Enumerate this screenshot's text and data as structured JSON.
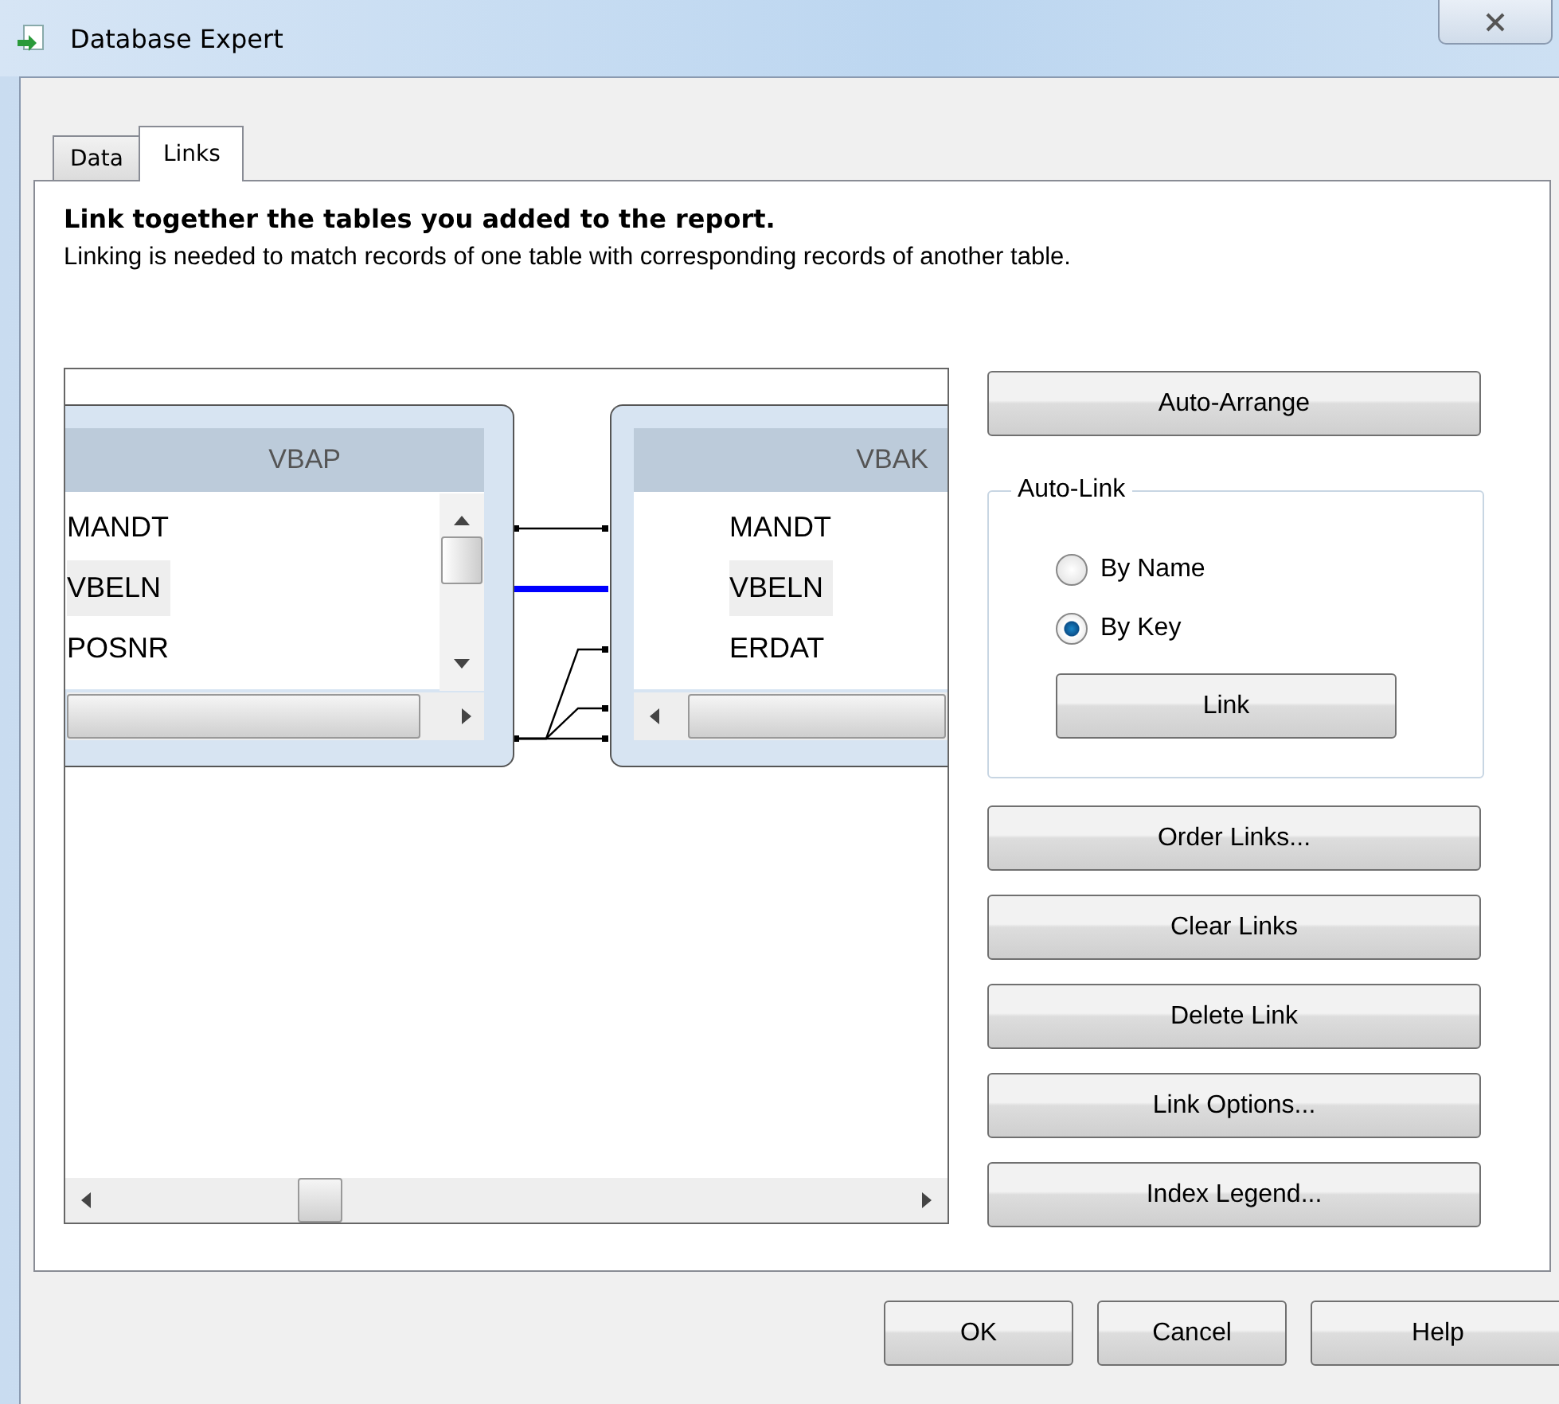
{
  "window": {
    "title": "Database Expert"
  },
  "tabs": [
    {
      "label": "Data",
      "selected": false
    },
    {
      "label": "Links",
      "selected": true
    }
  ],
  "heading": "Link together the tables you added to the report.",
  "description": "Linking is needed to match records of one table with corresponding records of another table.",
  "tables": [
    {
      "name": "VBAP",
      "fields": [
        {
          "label": "MANDT",
          "selected": false
        },
        {
          "label": "VBELN",
          "selected": true
        },
        {
          "label": "POSNR",
          "selected": false
        }
      ]
    },
    {
      "name": "VBAK",
      "fields": [
        {
          "label": "MANDT",
          "selected": false
        },
        {
          "label": "VBELN",
          "selected": true
        },
        {
          "label": "ERDAT",
          "selected": false
        }
      ]
    }
  ],
  "links": [
    {
      "selected": false
    },
    {
      "selected": true
    },
    {
      "selected": false
    },
    {
      "selected": false
    },
    {
      "selected": false
    }
  ],
  "auto_arrange": "Auto-Arrange",
  "auto_link": {
    "title": "Auto-Link",
    "options": [
      {
        "label": "By Name",
        "selected": false
      },
      {
        "label": "By Key",
        "selected": true
      }
    ],
    "button": "Link"
  },
  "actions": [
    "Order Links...",
    "Clear Links",
    "Delete Link",
    "Link Options...",
    "Index Legend..."
  ],
  "buttons": [
    "OK",
    "Cancel",
    "Help"
  ]
}
